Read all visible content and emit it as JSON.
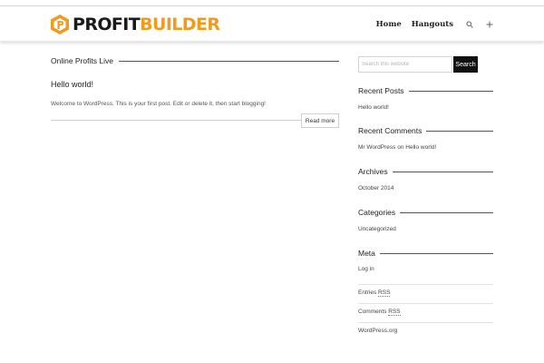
{
  "header": {
    "logo_profit": "PROFIT",
    "logo_builder": "BUILDER",
    "nav": [
      "Home",
      "Hangouts"
    ]
  },
  "main": {
    "section_title": "Online Profits Live",
    "post_title": "Hello world!",
    "post_excerpt": "Welcome to WordPress. This is your first post. Edit or delete it, then start blogging!",
    "read_more": "Read more"
  },
  "sidebar": {
    "search_placeholder": "Search this website",
    "search_button": "Search",
    "recent_posts_title": "Recent Posts",
    "recent_posts": [
      "Hello world!"
    ],
    "recent_comments_title": "Recent Comments",
    "comment_author": "Mr WordPress",
    "comment_on": "on",
    "comment_post": "Hello world!",
    "archives_title": "Archives",
    "archives": [
      "October 2014"
    ],
    "categories_title": "Categories",
    "categories": [
      "Uncategorized"
    ],
    "meta_title": "Meta",
    "meta": {
      "login": "Log in",
      "entries_prefix": "Entries",
      "comments_prefix": "Comments",
      "rss": "RSS",
      "wordpress": "WordPress.org"
    }
  },
  "colors": {
    "brand_orange": "#f39a1c",
    "search_button_bg": "#111111"
  },
  "icons": [
    "logo-hexagon-icon",
    "search-icon",
    "plus-icon"
  ]
}
